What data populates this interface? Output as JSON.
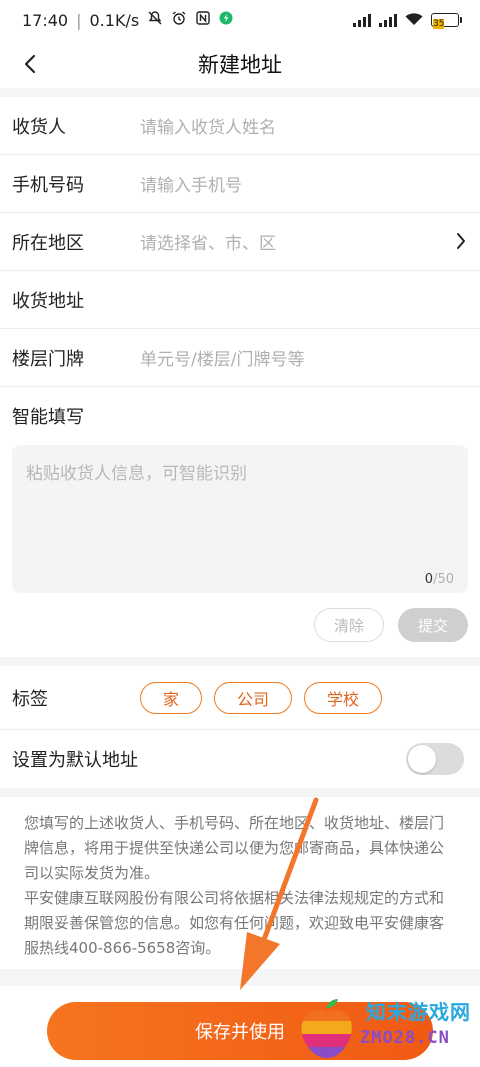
{
  "status_bar": {
    "time": "17:40",
    "speed": "0.1K/s",
    "battery": "35",
    "net1": "HD",
    "net2": "HD"
  },
  "nav": {
    "title": "新建地址"
  },
  "form": {
    "receiver": {
      "label": "收货人",
      "placeholder": "请输入收货人姓名"
    },
    "phone": {
      "label": "手机号码",
      "placeholder": "请输入手机号"
    },
    "region": {
      "label": "所在地区",
      "placeholder": "请选择省、市、区"
    },
    "address": {
      "label": "收货地址",
      "placeholder": ""
    },
    "floor": {
      "label": "楼层门牌",
      "placeholder": "单元号/楼层/门牌号等"
    }
  },
  "smart_fill": {
    "label": "智能填写",
    "placeholder": "粘贴收货人信息，可智能识别",
    "count_current": "0",
    "count_max": "/50",
    "clear_label": "清除",
    "submit_label": "提交"
  },
  "tags": {
    "label": "标签",
    "items": [
      "家",
      "公司",
      "学校"
    ]
  },
  "default_address": {
    "label": "设置为默认地址",
    "enabled": false
  },
  "notice": {
    "para1": "您填写的上述收货人、手机号码、所在地区、收货地址、楼层门牌信息，将用于提供至快递公司以便为您邮寄商品，具体快递公司以实际发货为准。",
    "para2": "平安健康互联网股份有限公司将依据相关法律法规规定的方式和期限妥善保管您的信息。如您有任何问题，欢迎致电平安健康客服热线400-866-5658咨询。"
  },
  "bottom": {
    "save_label": "保存并使用"
  },
  "watermark": {
    "line1": "知末游戏网",
    "line2": "ZMO28.CN"
  },
  "colors": {
    "accent": "#f06a1a",
    "arrow": "#f2772a"
  }
}
